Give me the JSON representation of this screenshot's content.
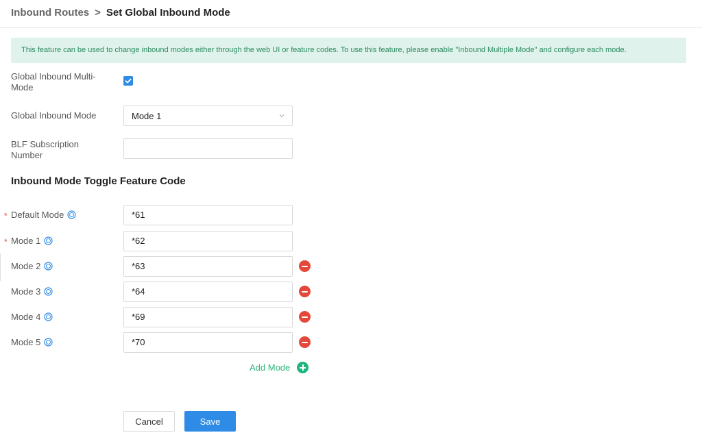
{
  "breadcrumb": {
    "parent": "Inbound Routes",
    "separator": ">",
    "current": "Set Global Inbound Mode"
  },
  "notice": "This feature can be used to change inbound modes either through the web UI or feature codes. To use this feature, please enable \"Inbound Multiple Mode\" and configure each mode.",
  "form": {
    "multi_mode": {
      "label_line1": "Global Inbound Multi-",
      "label_line2": "Mode",
      "checked": true
    },
    "global_mode": {
      "label": "Global Inbound Mode",
      "value": "Mode 1"
    },
    "blf": {
      "label_line1": "BLF Subscription",
      "label_line2": "Number",
      "value": ""
    }
  },
  "section_title": "Inbound Mode Toggle Feature Code",
  "modes": [
    {
      "label": "Default Mode",
      "value": "*61",
      "required": "*"
    },
    {
      "label": "Mode 1",
      "value": "*62",
      "required": "*"
    },
    {
      "label": "Mode 2",
      "value": "*63"
    },
    {
      "label": "Mode 3",
      "value": "*64"
    },
    {
      "label": "Mode 4",
      "value": "*69"
    },
    {
      "label": "Mode 5",
      "value": "*70"
    }
  ],
  "add_mode_label": "Add Mode",
  "buttons": {
    "cancel": "Cancel",
    "save": "Save"
  },
  "colors": {
    "accent": "#2e8ce6",
    "notice_bg": "#dff3ec",
    "notice_text": "#2b8a5f",
    "danger": "#e5483a",
    "success": "#1fb67e"
  },
  "icons": {
    "help": "question-circle-icon",
    "remove": "minus-circle-icon",
    "add": "plus-circle-icon",
    "check": "check-icon",
    "dropdown": "chevron-down-icon"
  }
}
